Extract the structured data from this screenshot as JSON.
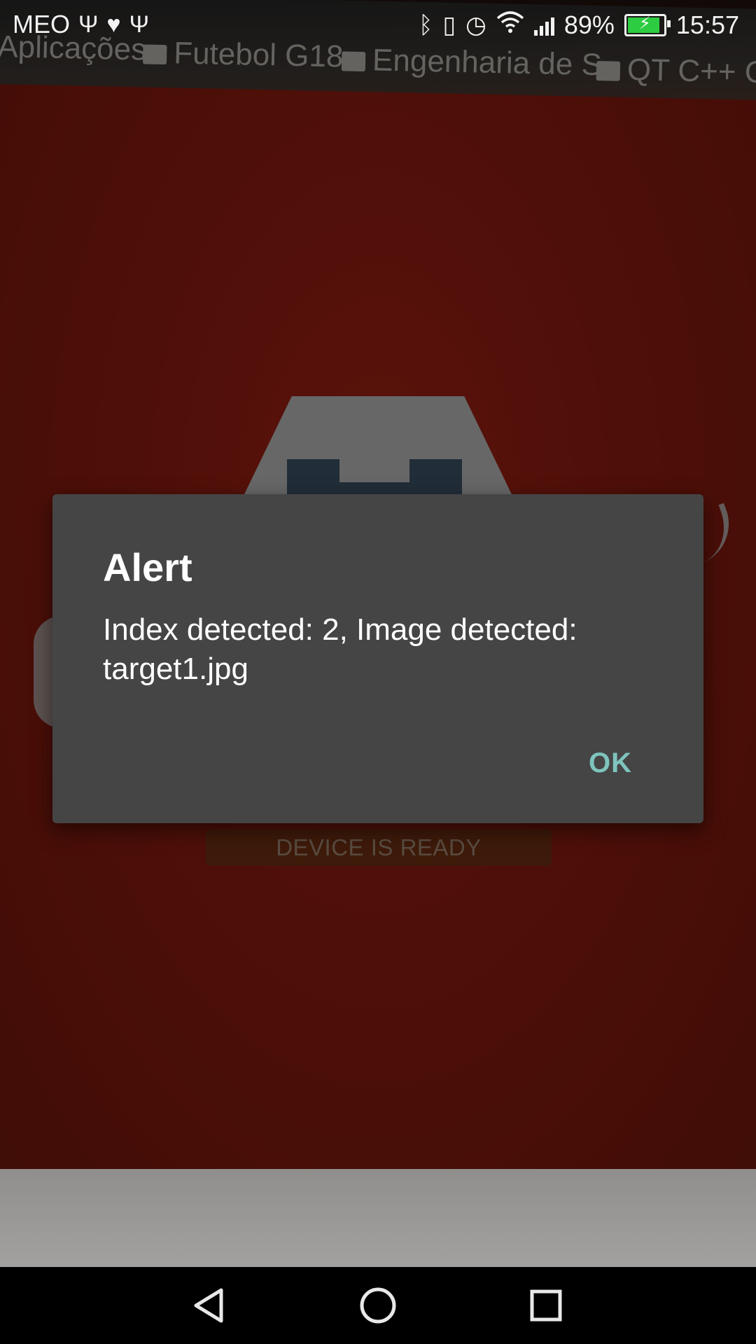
{
  "status_bar": {
    "carrier": "MEO",
    "battery_percent": "89%",
    "battery_level": 0.89,
    "time": "15:57",
    "left_icons": [
      "usb-icon",
      "health-icon",
      "usb-icon"
    ],
    "right_icons": [
      "bluetooth-icon",
      "vibrate-icon",
      "alarm-icon",
      "wifi-icon",
      "signal-icon",
      "battery-icon"
    ]
  },
  "background": {
    "bookmarks": [
      "Aplicações",
      "Futebol G18",
      "Engenharia de S",
      "QT C++ Ga"
    ],
    "url_fragment": "/profile_images/770407680",
    "device_ready_label": "DEVICE IS READY"
  },
  "dialog": {
    "title": "Alert",
    "message": "Index detected: 2, Image detected: target1.jpg",
    "ok_label": "OK"
  },
  "nav_bar": {
    "buttons": [
      "back-icon",
      "home-icon",
      "recents-icon"
    ]
  },
  "colors": {
    "dialog_bg": "#454545",
    "accent": "#7ec4bd",
    "battery_fill": "#2ecc40",
    "camera_red": "#6c1b0f"
  }
}
